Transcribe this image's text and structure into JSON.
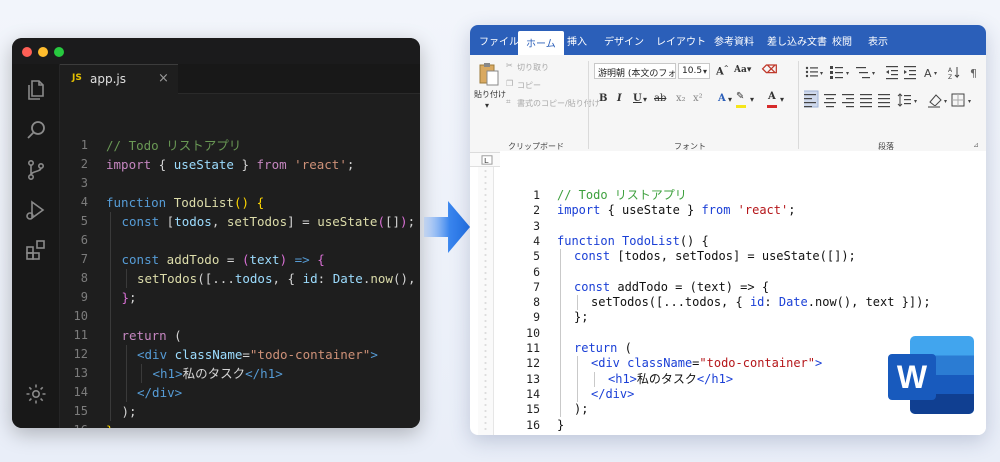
{
  "vscode": {
    "tab": {
      "badge": "JS",
      "filename": "app.js",
      "close": "×"
    },
    "activity_icons": [
      "files-icon",
      "search-icon",
      "source-control-icon",
      "run-debug-icon",
      "extensions-icon",
      "settings-icon"
    ],
    "lines": [
      {
        "n": "1",
        "indent": 0,
        "tokens": [
          [
            "c-com",
            "// Todo リストアプリ"
          ]
        ]
      },
      {
        "n": "2",
        "indent": 0,
        "tokens": [
          [
            "c-kw",
            "import"
          ],
          [
            "c-txt",
            " { "
          ],
          [
            "c-var",
            "useState"
          ],
          [
            "c-txt",
            " } "
          ],
          [
            "c-kw",
            "from"
          ],
          [
            "c-txt",
            " "
          ],
          [
            "c-str",
            "'react'"
          ],
          [
            "c-txt",
            ";"
          ]
        ]
      },
      {
        "n": "3",
        "indent": 0,
        "tokens": []
      },
      {
        "n": "4",
        "indent": 0,
        "tokens": [
          [
            "c-blue",
            "function"
          ],
          [
            "c-txt",
            " "
          ],
          [
            "c-fn",
            "TodoList"
          ],
          [
            "c-br",
            "()"
          ],
          [
            "c-txt",
            " "
          ],
          [
            "c-br",
            "{"
          ]
        ]
      },
      {
        "n": "5",
        "indent": 1,
        "tokens": [
          [
            "c-blue",
            "const"
          ],
          [
            "c-txt",
            " ["
          ],
          [
            "c-var",
            "todos"
          ],
          [
            "c-txt",
            ", "
          ],
          [
            "c-fn",
            "setTodos"
          ],
          [
            "c-txt",
            "] = "
          ],
          [
            "c-fn",
            "useState"
          ],
          [
            "c-br2",
            "("
          ],
          [
            "c-txt",
            "[]"
          ],
          [
            "c-br2",
            ")"
          ],
          [
            "c-txt",
            ";"
          ]
        ]
      },
      {
        "n": "6",
        "indent": 1,
        "tokens": []
      },
      {
        "n": "7",
        "indent": 1,
        "tokens": [
          [
            "c-blue",
            "const"
          ],
          [
            "c-txt",
            " "
          ],
          [
            "c-fn",
            "addTodo"
          ],
          [
            "c-txt",
            " = "
          ],
          [
            "c-br2",
            "("
          ],
          [
            "c-var",
            "text"
          ],
          [
            "c-br2",
            ")"
          ],
          [
            "c-txt",
            " "
          ],
          [
            "c-blue",
            "=>"
          ],
          [
            "c-txt",
            " "
          ],
          [
            "c-br2",
            "{"
          ]
        ]
      },
      {
        "n": "8",
        "indent": 2,
        "tokens": [
          [
            "c-fn",
            "setTodos"
          ],
          [
            "c-txt",
            "([..."
          ],
          [
            "c-var",
            "todos"
          ],
          [
            "c-txt",
            ", { "
          ],
          [
            "c-var",
            "id"
          ],
          [
            "c-txt",
            ": "
          ],
          [
            "c-var",
            "Date"
          ],
          [
            "c-txt",
            "."
          ],
          [
            "c-fn",
            "now"
          ],
          [
            "c-txt",
            "(), "
          ],
          [
            "c-var",
            "text"
          ],
          [
            "c-txt",
            " }]);"
          ]
        ]
      },
      {
        "n": "9",
        "indent": 1,
        "tokens": [
          [
            "c-br2",
            "}"
          ],
          [
            "c-txt",
            ";"
          ]
        ]
      },
      {
        "n": "10",
        "indent": 1,
        "tokens": []
      },
      {
        "n": "11",
        "indent": 1,
        "tokens": [
          [
            "c-kw",
            "return"
          ],
          [
            "c-txt",
            " ("
          ]
        ]
      },
      {
        "n": "12",
        "indent": 2,
        "tokens": [
          [
            "c-tag",
            "<div"
          ],
          [
            "c-txt",
            " "
          ],
          [
            "c-attr",
            "className"
          ],
          [
            "c-txt",
            "="
          ],
          [
            "c-str",
            "\"todo-container\""
          ],
          [
            "c-tag",
            ">"
          ]
        ]
      },
      {
        "n": "13",
        "indent": 3,
        "tokens": [
          [
            "c-tag",
            "<h1>"
          ],
          [
            "c-txt",
            "私のタスク"
          ],
          [
            "c-tag",
            "</h1>"
          ]
        ]
      },
      {
        "n": "14",
        "indent": 2,
        "tokens": [
          [
            "c-tag",
            "</div>"
          ]
        ]
      },
      {
        "n": "15",
        "indent": 1,
        "tokens": [
          [
            "c-txt",
            ");"
          ]
        ]
      },
      {
        "n": "16",
        "indent": 0,
        "tokens": [
          [
            "c-br",
            "}"
          ]
        ]
      }
    ]
  },
  "word": {
    "menu_tabs": [
      "ファイル",
      "ホーム",
      "挿入",
      "デザイン",
      "レイアウト",
      "参考資料",
      "差し込み文書",
      "校閲",
      "表示"
    ],
    "active_tab": "ホーム",
    "ribbon": {
      "paste": "貼り付け",
      "cut": "切り取り",
      "copy": "コピー",
      "format_painter": "書式のコピー/貼り付け",
      "font_name": "游明朝 (本文のフォント",
      "font_size": "10.5",
      "group_clipboard": "クリップボード",
      "group_font": "フォント",
      "group_paragraph": "段落"
    },
    "lines": [
      {
        "n": "1",
        "indent": 0,
        "tokens": [
          [
            "w-com",
            "// Todo リストアプリ"
          ]
        ]
      },
      {
        "n": "2",
        "indent": 0,
        "tokens": [
          [
            "w-kw",
            "import"
          ],
          [
            "w-txt",
            " { useState } "
          ],
          [
            "w-kw",
            "from"
          ],
          [
            "w-txt",
            " "
          ],
          [
            "w-str",
            "'react'"
          ],
          [
            "w-txt",
            ";"
          ]
        ]
      },
      {
        "n": "3",
        "indent": 0,
        "tokens": []
      },
      {
        "n": "4",
        "indent": 0,
        "tokens": [
          [
            "w-kw",
            "function"
          ],
          [
            "w-txt",
            " "
          ],
          [
            "w-kw",
            "TodoList"
          ],
          [
            "w-txt",
            "() {"
          ]
        ]
      },
      {
        "n": "5",
        "indent": 1,
        "tokens": [
          [
            "w-kw",
            "const"
          ],
          [
            "w-txt",
            " [todos, setTodos] = useState([]);"
          ]
        ]
      },
      {
        "n": "6",
        "indent": 1,
        "tokens": []
      },
      {
        "n": "7",
        "indent": 1,
        "tokens": [
          [
            "w-kw",
            "const"
          ],
          [
            "w-txt",
            " addTodo = (text) => {"
          ]
        ]
      },
      {
        "n": "8",
        "indent": 2,
        "tokens": [
          [
            "w-txt",
            "setTodos([...todos, { "
          ],
          [
            "w-id",
            "id"
          ],
          [
            "w-txt",
            ": "
          ],
          [
            "w-id",
            "Date"
          ],
          [
            "w-txt",
            ".now(), text }]);"
          ]
        ]
      },
      {
        "n": "9",
        "indent": 1,
        "tokens": [
          [
            "w-txt",
            "};"
          ]
        ]
      },
      {
        "n": "10",
        "indent": 1,
        "tokens": []
      },
      {
        "n": "11",
        "indent": 1,
        "tokens": [
          [
            "w-kw",
            "return"
          ],
          [
            "w-txt",
            " ("
          ]
        ]
      },
      {
        "n": "12",
        "indent": 2,
        "tokens": [
          [
            "w-kw",
            "<div"
          ],
          [
            "w-txt",
            " "
          ],
          [
            "w-kw",
            "className"
          ],
          [
            "w-txt",
            "="
          ],
          [
            "w-str",
            "\"todo-container\""
          ],
          [
            "w-kw",
            ">"
          ]
        ]
      },
      {
        "n": "13",
        "indent": 3,
        "tokens": [
          [
            "w-kw",
            "<h1>"
          ],
          [
            "w-txt",
            "私のタスク"
          ],
          [
            "w-kw",
            "</h1>"
          ]
        ]
      },
      {
        "n": "14",
        "indent": 2,
        "tokens": [
          [
            "w-kw",
            "</div>"
          ]
        ]
      },
      {
        "n": "15",
        "indent": 1,
        "tokens": [
          [
            "w-txt",
            ");"
          ]
        ]
      },
      {
        "n": "16",
        "indent": 0,
        "tokens": [
          [
            "w-txt",
            "}"
          ]
        ]
      }
    ],
    "logo_letter": "W"
  },
  "colors": {
    "vscode_bg": "#1e1e1e",
    "word_blue": "#2b5fb9",
    "arrow_blue": "#1f6fe5"
  }
}
